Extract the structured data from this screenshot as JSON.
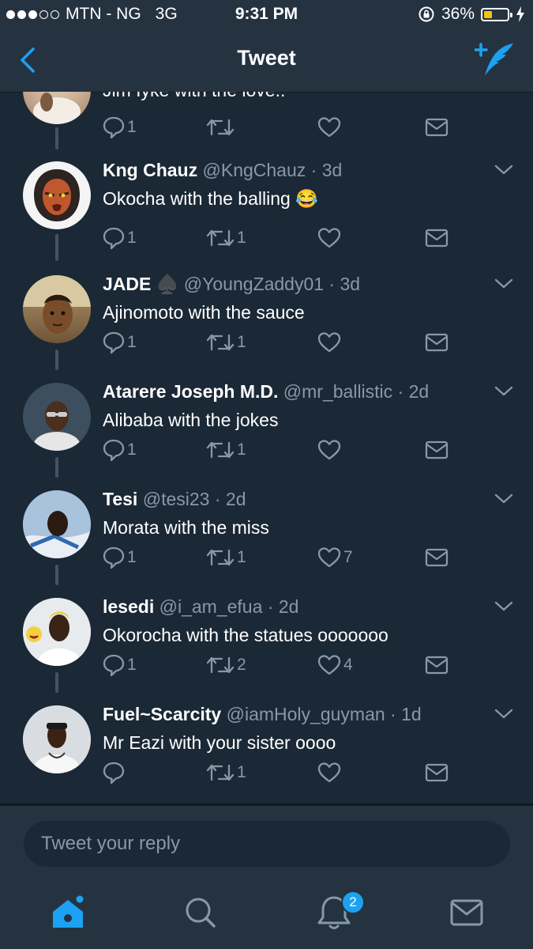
{
  "status_bar": {
    "carrier": "MTN - NG",
    "network": "3G",
    "time": "9:31 PM",
    "battery_percent": "36%",
    "battery_level": 0.36
  },
  "nav": {
    "title": "Tweet",
    "back_icon": "chevron-left-icon",
    "compose_icon": "compose-tweet-icon"
  },
  "partial_tweet": {
    "text": "Jim Iyke with the love.."
  },
  "tweets": [
    {
      "name": "Kng Chauz",
      "handle": "@KngChauz",
      "time": "3d",
      "text": "Okocha with the balling 😂",
      "replies": "1",
      "retweets": "1",
      "likes": ""
    },
    {
      "name": "JADE ♠️",
      "handle": "@YoungZaddy01",
      "time": "3d",
      "text": "Ajinomoto with the sauce",
      "replies": "1",
      "retweets": "1",
      "likes": ""
    },
    {
      "name": "Atarere Joseph M.D.",
      "handle": "@mr_ballistic",
      "time": "2d",
      "text": "Alibaba with the jokes",
      "replies": "1",
      "retweets": "1",
      "likes": ""
    },
    {
      "name": "Tesi",
      "handle": "@tesi23",
      "time": "2d",
      "text": "Morata with the miss",
      "replies": "1",
      "retweets": "1",
      "likes": "7"
    },
    {
      "name": "lesedi",
      "handle": "@i_am_efua",
      "time": "2d",
      "text": "Okorocha with the statues ooooooo",
      "replies": "1",
      "retweets": "2",
      "likes": "4"
    },
    {
      "name": "Fuel~Scarcity",
      "handle": "@iamHoly_guyman",
      "time": "1d",
      "text": "Mr Eazi with your sister oooo",
      "replies": "",
      "retweets": "1",
      "likes": ""
    }
  ],
  "partial_actions": {
    "replies": "1",
    "retweets": "",
    "likes": ""
  },
  "reply_box": {
    "placeholder": "Tweet your reply"
  },
  "tab_bar": {
    "tabs": [
      "home-icon",
      "search-icon",
      "notifications-icon",
      "messages-icon"
    ],
    "notification_badge": "2"
  },
  "colors": {
    "background": "#1b2836",
    "bar": "#253341",
    "accent": "#1da1f2",
    "muted": "#8899a6",
    "battery": "#f2c40f"
  }
}
